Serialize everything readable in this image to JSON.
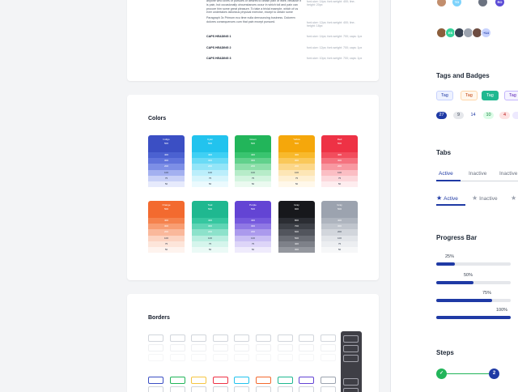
{
  "typography": {
    "rows": [
      {
        "text": "annoying consequences that are extremely painful. Nor again is there anyone who loves or pursues or desires to obtain pain of itself, because it is pain, but occasionally circumstances occur in which toil and pain can procure him some great pleasure. To take a trivial example, which of us ever undertakes laborious physical exercise, except to obtain some advantage from it?",
        "meta": "font-size: 14px; font-weight: 400; line-height: 20px"
      },
      {
        "text": "Paragraph 3x Primum ecu time nulla dernouncing business. Dolorem dolores consequences cum that pain except pursued.",
        "meta": "font-size: 12px; font-weight: 400; line-height: 18px"
      },
      {
        "text": "CAPS HEADING 1",
        "meta": "font-size: 14px; font-weight: 700; caps: 1px"
      },
      {
        "text": "CAPS HEADING 2",
        "meta": "font-size: 12px; font-weight: 700; caps: 1px"
      },
      {
        "text": "CAPS HEADING 3",
        "meta": "font-size: 10px; font-weight: 700; caps: 1px"
      }
    ]
  },
  "colors": {
    "title": "Colors",
    "swatches": [
      {
        "name": "Indigo",
        "base": "#3b4fc4",
        "bands": [
          "#3b4fc4",
          "#4b61d1",
          "#6074dc",
          "#7d8fe6",
          "#a3b0f0",
          "#c9d1f7",
          "#e6eafc"
        ],
        "labels": [
          "500",
          "400",
          "300",
          "200",
          "100",
          "75",
          "50"
        ]
      },
      {
        "name": "Cyan",
        "base": "#22c3ee",
        "bands": [
          "#22c3ee",
          "#3fd0f4",
          "#6adbf6",
          "#93e5f8",
          "#bbeefb",
          "#d6f5fc",
          "#ebfafe"
        ],
        "labels": [
          "500",
          "400",
          "300",
          "200",
          "100",
          "75",
          "50"
        ]
      },
      {
        "name": "Green",
        "base": "#22b55a",
        "bands": [
          "#22b55a",
          "#39c46f",
          "#61d18c",
          "#8ddfaa",
          "#b7ecc9",
          "#d3f4df",
          "#ebfaf0"
        ],
        "labels": [
          "500",
          "400",
          "300",
          "200",
          "100",
          "75",
          "50"
        ]
      },
      {
        "name": "Yellow",
        "base": "#f5a70b",
        "bands": [
          "#f5a70b",
          "#f8b92c",
          "#fac85a",
          "#fcd789",
          "#fde6b6",
          "#fef0d3",
          "#fff8ea"
        ],
        "labels": [
          "500",
          "400",
          "300",
          "200",
          "100",
          "75",
          "50"
        ]
      },
      {
        "name": "Red",
        "base": "#ee3245",
        "bands": [
          "#ee3245",
          "#f24d5d",
          "#f5727f",
          "#f898a1",
          "#fbbec4",
          "#fcd8dc",
          "#feedef"
        ],
        "labels": [
          "500",
          "400",
          "300",
          "200",
          "100",
          "75",
          "50"
        ]
      },
      {
        "name": "Orange",
        "base": "#f36a2f",
        "bands": [
          "#f36a2f",
          "#f5824d",
          "#f89d73",
          "#fab89b",
          "#fcd4c2",
          "#fde5da",
          "#fef3ee"
        ],
        "labels": [
          "500",
          "400",
          "300",
          "200",
          "100",
          "75",
          "50"
        ]
      },
      {
        "name": "Teal",
        "base": "#1fb890",
        "bands": [
          "#1fb890",
          "#36c7a0",
          "#5fd5b5",
          "#8de2cb",
          "#b9eee0",
          "#d5f5ec",
          "#ebfaf6"
        ],
        "labels": [
          "500",
          "400",
          "300",
          "200",
          "100",
          "75",
          "50"
        ]
      },
      {
        "name": "Purple",
        "base": "#6344d4",
        "bands": [
          "#6344d4",
          "#7559dd",
          "#8f78e5",
          "#ab9aed",
          "#c9bef4",
          "#ddd5f8",
          "#efebfc"
        ],
        "labels": [
          "500",
          "400",
          "300",
          "200",
          "100",
          "75",
          "50"
        ]
      },
      {
        "name": "Gray",
        "base": "#17181c",
        "bands": [
          "#17181c",
          "#2b2d33",
          "#3d4047",
          "#52555d",
          "#696c74",
          "#7e8189",
          "#94979e"
        ],
        "labels": [
          "900",
          "800",
          "700",
          "600",
          "500",
          "400",
          "300"
        ]
      },
      {
        "name": "Gray",
        "base": "#9ca3af",
        "bands": [
          "#9ca3af",
          "#aeb4be",
          "#c0c5cd",
          "#d2d6dc",
          "#e2e5e9",
          "#eceef1",
          "#f6f7f8"
        ],
        "labels": [
          "500",
          "400",
          "300",
          "200",
          "100",
          "75",
          "50"
        ]
      }
    ]
  },
  "borders": {
    "title": "Borders",
    "colors": [
      "#3b4fc4",
      "#22b55a",
      "#f5c542",
      "#ee3245",
      "#22c3ee",
      "#f36a2f",
      "#1fb890",
      "#6344d4",
      "#9ca3af"
    ]
  },
  "sidebar": {
    "avatars_top": [
      {
        "initials": "",
        "color": "#c28e6d"
      },
      {
        "initials": "TO",
        "color": "#7dd3fc"
      },
      {
        "initials": "",
        "color": "#6b7280"
      },
      {
        "initials": "RO",
        "color": "#5b4bd6"
      }
    ],
    "avatars_group": [
      {
        "initials": "",
        "color": "#8b5e3c"
      },
      {
        "initials": "ES",
        "color": "#34d399"
      },
      {
        "initials": "",
        "color": "#374151"
      },
      {
        "initials": "",
        "color": "#9ca3af"
      },
      {
        "initials": "",
        "color": "#6d4c41"
      },
      {
        "initials": "+14",
        "color": "#c7d2fe"
      }
    ],
    "tags_title": "Tags and Badges",
    "tags": [
      {
        "label": "Tag",
        "bg": "#eef2ff",
        "fg": "#1f3aa5",
        "border": "#c7d2fe"
      },
      {
        "label": "Tag",
        "bg": "#fff7ed",
        "fg": "#c2410c",
        "border": "#fed7aa"
      },
      {
        "label": "Tag",
        "bg": "#1fb890",
        "fg": "#ffffff",
        "border": "#1fb890"
      },
      {
        "label": "Tag",
        "bg": "#f5f3ff",
        "fg": "#5b21b6",
        "border": "#c4b5fd"
      }
    ],
    "badges": [
      {
        "label": "27",
        "bg": "#1f3aa5",
        "fg": "#ffffff"
      },
      {
        "label": "9",
        "bg": "#e5e7eb",
        "fg": "#374151"
      },
      {
        "label": "14",
        "bg": "#ffffff",
        "fg": "#1f3aa5"
      },
      {
        "label": "10",
        "bg": "#dcfce7",
        "fg": "#15803d"
      },
      {
        "label": "4",
        "bg": "#fee2e2",
        "fg": "#b91c1c"
      },
      {
        "label": "",
        "bg": "#ede9fe",
        "fg": "#5b21b6"
      }
    ],
    "tabs_title": "Tabs",
    "tabs": [
      "Active",
      "Inactive",
      "Inactive"
    ],
    "star_tabs": [
      "Active",
      "Inactive",
      ""
    ],
    "progress_title": "Progress Bar",
    "progress": [
      {
        "label": "25%",
        "value": 0.25
      },
      {
        "label": "50%",
        "value": 0.5
      },
      {
        "label": "75%",
        "value": 0.75
      },
      {
        "label": "100%",
        "value": 1.0
      }
    ],
    "steps_title": "Steps",
    "steps": [
      {
        "label": "✓",
        "color": "#22b55a"
      },
      {
        "label": "2",
        "color": "#1f3aa5"
      }
    ]
  }
}
